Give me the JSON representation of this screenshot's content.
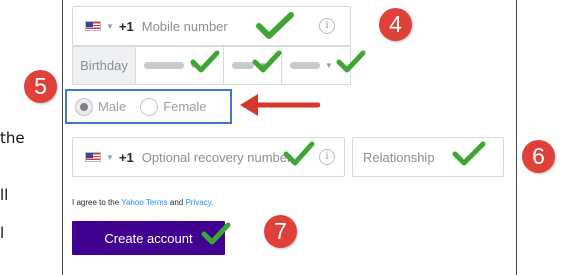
{
  "left_text": [
    "the",
    "ll",
    "l"
  ],
  "phone": {
    "country_code": "+1",
    "placeholder": "Mobile number",
    "info_icon": "info-icon"
  },
  "birthday": {
    "label": "Birthday"
  },
  "gender": {
    "options": [
      "Male",
      "Female"
    ],
    "selected": "Male"
  },
  "recovery": {
    "country_code": "+1",
    "placeholder": "Optional recovery number"
  },
  "relationship": {
    "placeholder": "Relationship"
  },
  "terms": {
    "prefix": "I agree to the",
    "link_terms": "Yahoo Terms",
    "and": "and",
    "link_privacy": "Privacy",
    "suffix": "."
  },
  "create_button": "Create account",
  "callouts": [
    "4",
    "5",
    "6",
    "7"
  ],
  "colors": {
    "button": "#400090",
    "link": "#188fff",
    "highlight_border": "#3d79c9",
    "badge": "#e0403a",
    "check": "#3ea734",
    "arrow": "#d7352d"
  }
}
